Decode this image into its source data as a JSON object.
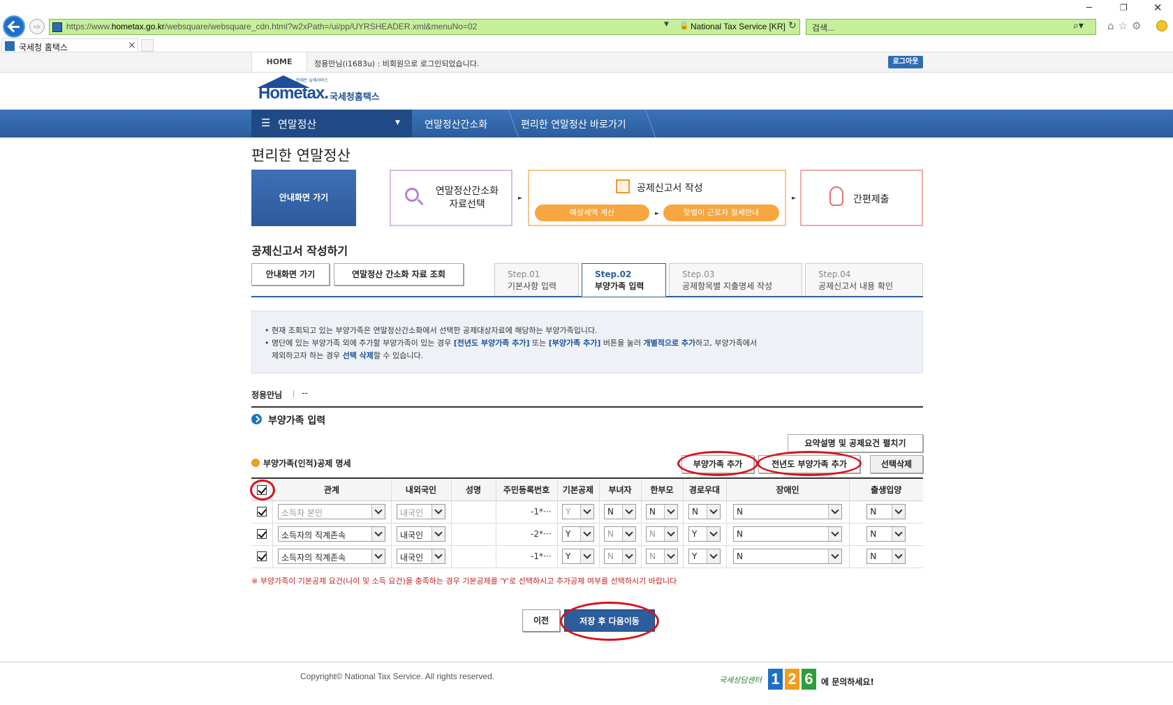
{
  "browser": {
    "url_prefix": "https://www.",
    "url_domain": "hometax.go.kr",
    "url_path": "/websquare/websquare_cdn.html?w2xPath=/ui/pp/UYRSHEADER.xml&menuNo=02",
    "cert": "National Tax Service [KR]",
    "search_placeholder": "검색...",
    "tab_title": "국세청 홈택스"
  },
  "topbar": {
    "home": "HOME",
    "login_message": "정용만님(i1683u) : 비회원으로 로그인되었습니다.",
    "logout": "로그아웃"
  },
  "logo": {
    "small": "언제든 납세서비스",
    "home": "Hometax.",
    "name": "국세청홈택스"
  },
  "nav": {
    "menu": "연말정산",
    "items": [
      "연말정산간소화",
      "편리한 연말정산 바로가기"
    ]
  },
  "page": {
    "title": "편리한 연말정산",
    "guide_button": "안내화면 가기"
  },
  "process": {
    "step1": "연말정산간소화\n자료선택",
    "step2": "공제신고서 작성",
    "step2_sub1": "예상세액 계산",
    "step2_sub2": "맞벌이 근로자 절세안내",
    "step3": "간편제출"
  },
  "section": {
    "title": "공제신고서 작성하기",
    "buttons": [
      "안내화면 가기",
      "연말정산 간소화 자료 조회"
    ],
    "tabs": [
      {
        "step": "Step.01",
        "label": "기본사항 입력"
      },
      {
        "step": "Step.02",
        "label": "부양가족 입력"
      },
      {
        "step": "Step.03",
        "label": "공제항목별 지출명세 작성"
      },
      {
        "step": "Step.04",
        "label": "공제신고서 내용 확인"
      }
    ],
    "active_tab": 1
  },
  "info": {
    "line1": "현재 조회되고 있는 부양가족은 연말정산간소화에서 선택한 공제대상자료에 해당하는 부양가족입니다.",
    "line2_a": "명단에 있는 부양가족 외에 추가할 부양가족이 있는 경우 ",
    "line2_b": "[전년도 부양가족 추가]",
    "line2_c": " 또는 ",
    "line2_d": "[부양가족 추가]",
    "line2_e": " 버튼을 눌러 ",
    "line2_f": "개별적으로 추가",
    "line2_g": "하고, 부양가족에서",
    "line3_a": "제외하고자 하는 경우 ",
    "line3_b": "선택 삭제",
    "line3_c": "할 수 있습니다."
  },
  "name": {
    "label": "정용만님",
    "value": "--"
  },
  "dependents": {
    "section_title": "부양가족 입력",
    "expand_button": "요약설명 및 공제요건 펼치기",
    "list_title": "부양가족(인적)공제 명세",
    "add_button": "부양가족 추가",
    "prev_year_button": "전년도 부양가족 추가",
    "delete_button": "선택삭제",
    "columns": [
      "관계",
      "내외국인",
      "성명",
      "주민등록번호",
      "기본공제",
      "부녀자",
      "한부모",
      "경로우대",
      "장애인",
      "출생입양"
    ],
    "header_checked": true,
    "rows": [
      {
        "checked": true,
        "relation": "소득자 본인",
        "relation_disabled": true,
        "nationality": "내국인",
        "nat_disabled": true,
        "name": "",
        "rrn": "-1*···",
        "basic": "Y",
        "basic_disabled": true,
        "woman": "N",
        "woman_disabled": false,
        "single_parent": "N",
        "sp_disabled": false,
        "elderly": "N",
        "eld_disabled": false,
        "disabled": "N",
        "birth": "N"
      },
      {
        "checked": true,
        "relation": "소득자의 직계존속",
        "relation_disabled": false,
        "nationality": "내국인",
        "nat_disabled": false,
        "name": "",
        "rrn": "-2*···",
        "basic": "Y",
        "basic_disabled": false,
        "woman": "N",
        "woman_disabled": true,
        "single_parent": "N",
        "sp_disabled": true,
        "elderly": "Y",
        "eld_disabled": false,
        "disabled": "N",
        "birth": "N"
      },
      {
        "checked": true,
        "relation": "소득자의 직계존속",
        "relation_disabled": false,
        "nationality": "내국인",
        "nat_disabled": false,
        "name": "",
        "rrn": "-1*···",
        "basic": "Y",
        "basic_disabled": false,
        "woman": "N",
        "woman_disabled": true,
        "single_parent": "N",
        "sp_disabled": true,
        "elderly": "Y",
        "eld_disabled": false,
        "disabled": "N",
        "birth": "N"
      }
    ],
    "note": "※ 부양가족이 기본공제 요건(나이 및 소득 요건)을 충족하는 경우 기본공제를 'Y'로 선택하시고 추가공제 여부를 선택하시기 바랍니다"
  },
  "actions": {
    "prev": "이전",
    "save_next": "저장 후 다음이동"
  },
  "footer": {
    "copyright": "Copyright© National Tax Service. All rights reserved.",
    "contact_pre": "국세상담센터",
    "contact_num": "126",
    "contact_post": "에 문의하세요!"
  },
  "colors": {
    "nav_blue": "#2c5d9d",
    "annotation_red": "#d8121b",
    "address_green": "#c6ef9a"
  }
}
